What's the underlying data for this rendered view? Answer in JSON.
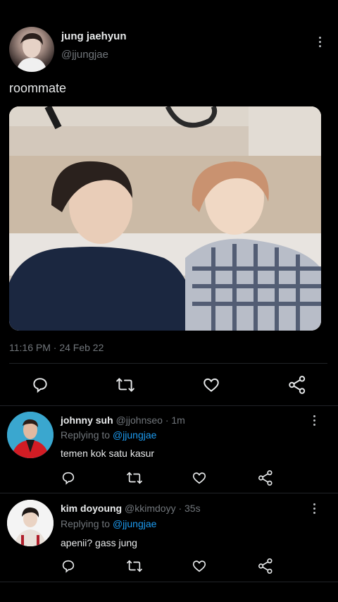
{
  "tweet": {
    "author_name": "jung jaehyun",
    "author_handle": "@jjungjae",
    "text": "roommate",
    "timestamp": "11:16 PM · 24 Feb 22"
  },
  "actions": {
    "reply_icon": "speech-bubble-icon",
    "retweet_icon": "retweet-icon",
    "like_icon": "heart-icon",
    "share_icon": "share-icon"
  },
  "replies": [
    {
      "name": "johnny suh",
      "handle": "@jjohnseo",
      "time": "· 1m",
      "replying_prefix": "Replying to",
      "replying_to": "@jjungjae",
      "text": "temen kok satu kasur"
    },
    {
      "name": "kim doyoung",
      "handle": "@kkimdoyy",
      "time": "· 35s",
      "replying_prefix": "Replying to",
      "replying_to": "@jjungjae",
      "text": "apenii? gass jung"
    }
  ],
  "colors": {
    "background": "#000000",
    "text": "#e7e9ea",
    "muted": "#71767b",
    "link": "#1d9bf0"
  }
}
